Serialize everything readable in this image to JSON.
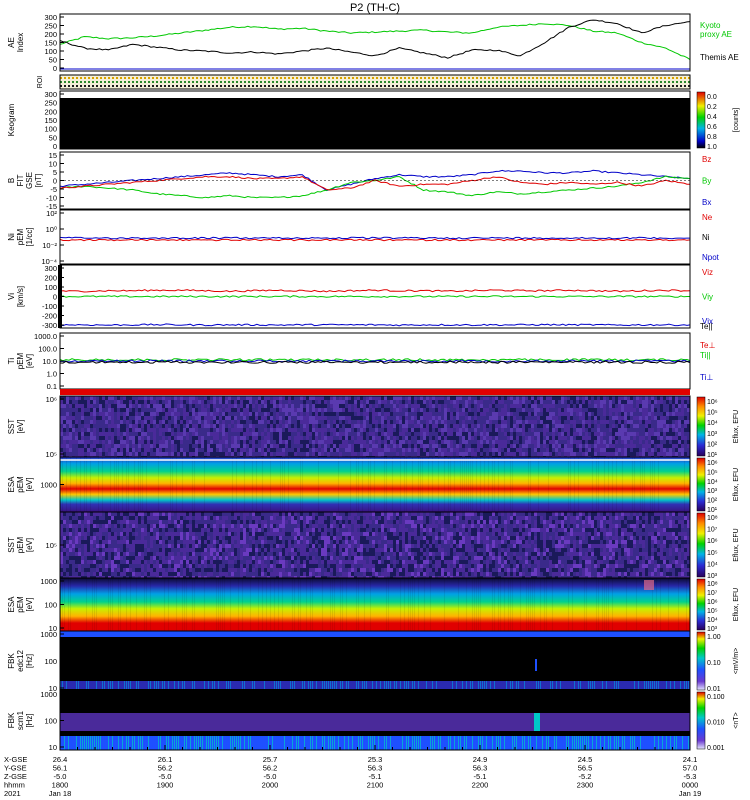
{
  "title": "P2 (TH-C)",
  "colors": {
    "red": "#e00000",
    "green": "#00c800",
    "blue": "#0000c8",
    "black": "#000000"
  },
  "chart_data": [
    {
      "id": "ae",
      "type": "line",
      "ylabel": "AE Index",
      "yticks": [
        "0",
        "50",
        "100",
        "150",
        "200",
        "250",
        "300"
      ],
      "ylim": [
        0,
        300
      ],
      "legend": [
        "Kyoto proxy AE",
        "Themis AE"
      ],
      "series": [
        {
          "name": "Kyoto proxy AE",
          "color": "#00c800",
          "values": [
            140,
            180,
            170,
            175,
            185,
            200,
            215,
            230,
            235,
            220,
            225,
            210,
            200,
            205,
            210,
            215,
            205,
            200,
            230,
            240,
            250,
            240,
            210,
            200,
            150,
            120,
            60
          ]
        },
        {
          "name": "Themis AE",
          "color": "#000000",
          "values": [
            160,
            120,
            110,
            140,
            125,
            110,
            105,
            95,
            100,
            90,
            105,
            120,
            100,
            80,
            120,
            95,
            70,
            110,
            110,
            80,
            150,
            230,
            270,
            250,
            200,
            240,
            260
          ]
        }
      ]
    },
    {
      "id": "roi",
      "type": "heatmap",
      "ylabel": "ROI"
    },
    {
      "id": "keogram",
      "type": "heatmap",
      "ylabel": "Keogram",
      "yticks": [
        "0",
        "50",
        "100",
        "150",
        "200",
        "250",
        "300"
      ],
      "ylim": [
        0,
        300
      ],
      "colorbar": {
        "label": "[counts]",
        "ticks": [
          "0.0",
          "0.2",
          "0.4",
          "0.6",
          "0.8",
          "1.0"
        ]
      }
    },
    {
      "id": "bfield",
      "type": "line",
      "ylabel": "B FIT GSE [nT]",
      "yticks": [
        "15",
        "10",
        "5",
        "0",
        "-5",
        "-10",
        "-15"
      ],
      "ylim": [
        -15,
        15
      ],
      "legend": [
        "Bz",
        "By",
        "Bx"
      ],
      "series": [
        {
          "name": "Bx",
          "color": "#0000c8",
          "values": [
            -3,
            -2,
            -1,
            0,
            1,
            2,
            3,
            4,
            3,
            2,
            3,
            -5,
            -2,
            1,
            3,
            2,
            2,
            3,
            5,
            5,
            4,
            4,
            5,
            4,
            3,
            2,
            1
          ]
        },
        {
          "name": "By",
          "color": "#00c800",
          "values": [
            -4,
            -3,
            -4,
            -5,
            -7,
            -8,
            -9,
            -8,
            -9,
            -9,
            -8,
            -5,
            -1,
            0,
            2,
            -5,
            -6,
            -8,
            -6,
            -7,
            -6,
            -5,
            -4,
            -3,
            -1,
            2,
            1
          ]
        },
        {
          "name": "Bz",
          "color": "#e00000",
          "values": [
            -4,
            -3,
            -2,
            -1,
            0,
            1,
            2,
            2,
            1,
            1,
            2,
            -5,
            -4,
            0,
            -3,
            -2,
            -2,
            0,
            2,
            -1,
            -2,
            -1,
            -2,
            -1,
            -3,
            0,
            -2
          ]
        }
      ]
    },
    {
      "id": "density",
      "type": "line",
      "ylabel": "Ni pEM [1/cc]",
      "yticks": [
        "10²",
        "10⁰",
        "10⁻²",
        "10⁻⁴"
      ],
      "legend": [
        "Ne",
        "Ni",
        "Npot"
      ]
    },
    {
      "id": "velocity",
      "type": "line",
      "ylabel": "Vi [km/s]",
      "yticks": [
        "300",
        "200",
        "100",
        "0",
        "-100",
        "-200",
        "-300"
      ],
      "ylim": [
        -300,
        300
      ],
      "legend": [
        "Viz",
        "Viy",
        "Vix"
      ],
      "series": [
        {
          "name": "Viz",
          "color": "#e00000",
          "values": [
            50,
            50,
            55,
            55,
            60,
            60,
            55,
            50,
            55,
            60,
            55,
            50,
            55,
            60,
            55,
            55,
            50,
            55,
            60,
            55,
            55,
            60,
            55,
            50,
            55,
            60,
            55
          ]
        },
        {
          "name": "Viy",
          "color": "#00c800",
          "values": [
            0,
            0,
            0,
            0,
            0,
            0,
            0,
            0,
            0,
            0,
            0,
            0,
            0,
            0,
            0,
            0,
            0,
            0,
            0,
            0,
            0,
            0,
            0,
            0,
            0,
            0,
            0
          ]
        },
        {
          "name": "Vix",
          "color": "#0000c8",
          "values": [
            -270,
            -270,
            -272,
            -270,
            -268,
            -270,
            -272,
            -270,
            -270,
            -271,
            -270,
            -269,
            -270,
            -270,
            -272,
            -270,
            -270,
            -271,
            -270,
            -270,
            -269,
            -270,
            -270,
            -272,
            -270,
            -270,
            -270
          ]
        }
      ]
    },
    {
      "id": "temperature",
      "type": "line",
      "ylabel": "Ti pEM [eV]",
      "yticks": [
        "1000.0",
        "100.0",
        "10.0",
        "1.0",
        "0.1"
      ],
      "legend": [
        "Te||",
        "Te⊥",
        "Ti||",
        "Ti⊥"
      ]
    },
    {
      "id": "sst_top",
      "type": "heatmap",
      "ylabel": "SST [eV]",
      "yticks": [
        "10⁶",
        "10⁵"
      ],
      "colorbar": {
        "label": "Eflux, EFU",
        "ticks": [
          "10⁶",
          "10⁵",
          "10⁴",
          "10³",
          "10²",
          "10¹"
        ]
      }
    },
    {
      "id": "esa_top",
      "type": "heatmap",
      "ylabel": "ESA pEM [eV]",
      "yticks": [
        "1000"
      ],
      "colorbar": {
        "label": "Eflux, EFU",
        "ticks": [
          "10⁶",
          "10⁵",
          "10⁴",
          "10³",
          "10²",
          "10¹"
        ]
      }
    },
    {
      "id": "sst_bottom",
      "type": "heatmap",
      "ylabel": "SST pEM [eV]",
      "yticks": [
        "10⁵"
      ],
      "colorbar": {
        "label": "Eflux, EFU",
        "ticks": [
          "10⁸",
          "10⁷",
          "10⁶",
          "10⁵",
          "10⁴",
          "10³"
        ]
      }
    },
    {
      "id": "esa_bottom",
      "type": "heatmap",
      "ylabel": "ESA pEM [eV]",
      "yticks": [
        "1000",
        "100",
        "10"
      ],
      "colorbar": {
        "label": "Eflux, EFU",
        "ticks": [
          "10⁸",
          "10⁷",
          "10⁶",
          "10⁵",
          "10⁴",
          "10³"
        ]
      }
    },
    {
      "id": "fbk_edc12",
      "type": "heatmap",
      "ylabel": "FBK edc12 [Hz]",
      "yticks": [
        "1000",
        "100",
        "10"
      ],
      "colorbar": {
        "label": "<mV/m>",
        "ticks": [
          "1.00",
          "0.10",
          "0.01"
        ]
      }
    },
    {
      "id": "fbk_scm1",
      "type": "heatmap",
      "ylabel": "FBK scm1 [Hz]",
      "yticks": [
        "1000",
        "100",
        "10"
      ],
      "colorbar": {
        "label": "<nT>",
        "ticks": [
          "0.100",
          "0.010",
          "0.001"
        ]
      }
    }
  ],
  "time_axis": {
    "row_labels": [
      "X-GSE",
      "Y-GSE",
      "Z-GSE",
      "hhmm",
      "2021"
    ],
    "columns": [
      {
        "x": "26.4",
        "y": "56.1",
        "z": "-5.0",
        "hhmm": "1800",
        "date": "Jan 18"
      },
      {
        "x": "26.1",
        "y": "56.2",
        "z": "-5.0",
        "hhmm": "1900",
        "date": ""
      },
      {
        "x": "25.7",
        "y": "56.2",
        "z": "-5.0",
        "hhmm": "2000",
        "date": ""
      },
      {
        "x": "25.3",
        "y": "56.3",
        "z": "-5.1",
        "hhmm": "2100",
        "date": ""
      },
      {
        "x": "24.9",
        "y": "56.3",
        "z": "-5.1",
        "hhmm": "2200",
        "date": ""
      },
      {
        "x": "24.5",
        "y": "56.5",
        "z": "-5.2",
        "hhmm": "2300",
        "date": ""
      },
      {
        "x": "24.1",
        "y": "57.0",
        "z": "-5.3",
        "hhmm": "0000",
        "date": "Jan 19"
      }
    ]
  }
}
